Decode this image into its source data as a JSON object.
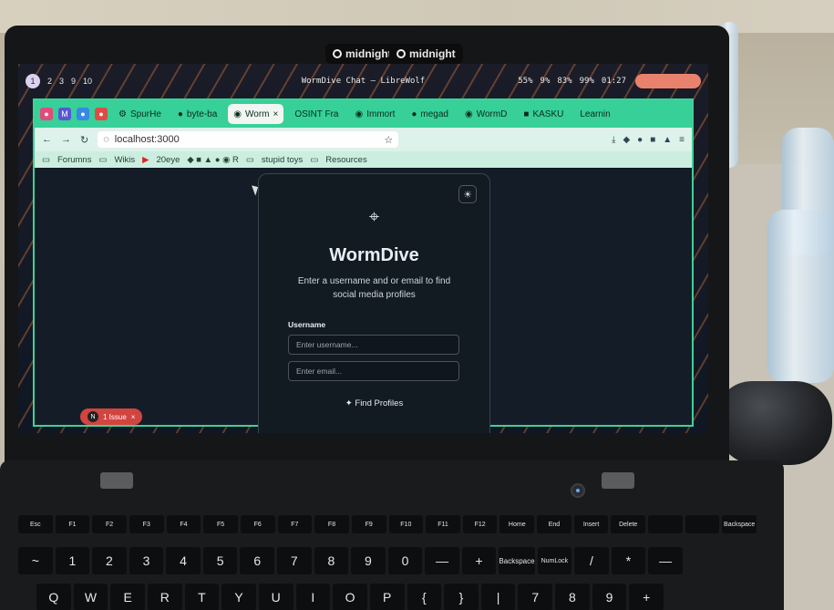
{
  "webcam_tags": [
    "midnight",
    "midnight"
  ],
  "desktop": {
    "workspaces": [
      "1",
      "2",
      "3",
      "9",
      "10"
    ],
    "window_title": "WormDive Chat — LibreWolf",
    "stats": [
      "55%",
      "9%",
      "83%",
      "99%",
      "01:27"
    ]
  },
  "browser": {
    "tabs": [
      {
        "label": "SpurHe",
        "active": false
      },
      {
        "label": "byte-ba",
        "active": false
      },
      {
        "label": "Worm",
        "active": true
      },
      {
        "label": "OSINT Fra",
        "active": false
      },
      {
        "label": "Immort",
        "active": false
      },
      {
        "label": "megad",
        "active": false
      },
      {
        "label": "WormD",
        "active": false
      },
      {
        "label": "KASKU",
        "active": false
      },
      {
        "label": "Learnin",
        "active": false
      }
    ],
    "url": "localhost:3000",
    "bookmarks": [
      "Forumns",
      "Wikis",
      "20eye",
      "stupid toys",
      "Resources"
    ]
  },
  "app": {
    "title": "WormDive",
    "subtitle": "Enter a username and or email to find social media profiles",
    "username_label": "Username",
    "username_placeholder": "Enter username...",
    "email_placeholder": "Enter email...",
    "submit_label": "Find Profiles",
    "issue_badge": "1 Issue",
    "issue_avatar": "N"
  },
  "keyboard": {
    "fn_row": [
      "Esc",
      "F1",
      "F2",
      "F3",
      "F4",
      "F5",
      "F6",
      "F7",
      "F8",
      "F9",
      "F10",
      "F11",
      "F12",
      "Home",
      "End",
      "Insert",
      "Delete",
      "",
      "",
      "Backspace"
    ],
    "num_row": [
      "~",
      "1",
      "2",
      "3",
      "4",
      "5",
      "6",
      "7",
      "8",
      "9",
      "0",
      "—",
      "+",
      "Backspace",
      "NumLock",
      "/",
      "*",
      "—"
    ],
    "top_row": [
      "Q",
      "W",
      "E",
      "R",
      "T",
      "Y",
      "U",
      "I",
      "O",
      "P",
      "{",
      "}",
      "|",
      "7",
      "8",
      "9",
      "+"
    ]
  }
}
